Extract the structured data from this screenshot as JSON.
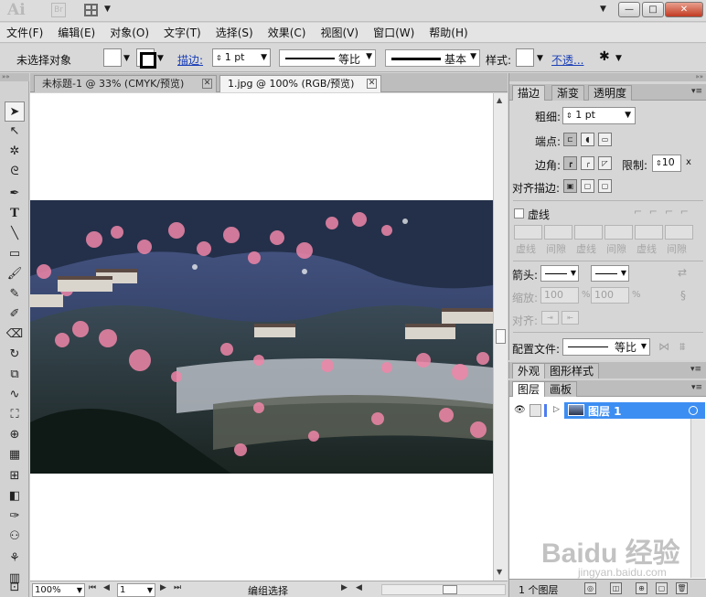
{
  "app": {
    "logo": "Ai",
    "bridge_label": "Br"
  },
  "window_buttons": {
    "minimize": "—",
    "maximize": "□",
    "close": "✕"
  },
  "menu": [
    "文件(F)",
    "编辑(E)",
    "对象(O)",
    "文字(T)",
    "选择(S)",
    "效果(C)",
    "视图(V)",
    "窗口(W)",
    "帮助(H)"
  ],
  "control_bar": {
    "selection_status": "未选择对象",
    "stroke_label": "描边:",
    "stroke_weight": "1 pt",
    "profile_label": "等比",
    "brush_label": "基本",
    "style_label": "样式:",
    "opacity_label": "不透..."
  },
  "doc_tabs": [
    {
      "label": "未标题-1 @ 33% (CMYK/预览)",
      "active": false
    },
    {
      "label": "1.jpg @ 100% (RGB/预览)",
      "active": true
    }
  ],
  "status_bar": {
    "zoom": "100%",
    "page": "1",
    "mode": "编组选择"
  },
  "stroke_panel": {
    "tabs": [
      "描边",
      "渐变",
      "透明度"
    ],
    "weight_label": "粗细:",
    "weight_value": "1 pt",
    "cap_label": "端点:",
    "corner_label": "边角:",
    "limit_label": "限制:",
    "limit_value": "10",
    "limit_unit": "x",
    "align_label": "对齐描边:",
    "dashed_label": "虚线",
    "dash_labels": [
      "虚线",
      "间隙",
      "虚线",
      "间隙",
      "虚线",
      "间隙"
    ],
    "arrow_label": "箭头:",
    "scale_label": "缩放:",
    "scale_left": "100",
    "scale_right": "100",
    "percent": "%",
    "align_arrow_label": "对齐:",
    "profile_label": "配置文件:",
    "profile_value": "等比"
  },
  "appearance_panel": {
    "tabs": [
      "外观",
      "图形样式"
    ]
  },
  "layers_panel": {
    "tabs": [
      "图层",
      "画板"
    ],
    "layer_name": "图层 1",
    "count": "1 个图层"
  },
  "watermark": {
    "main": "Baidu 经验",
    "sub": "jingyan.baidu.com"
  },
  "colors": {
    "selection_blue": "#3d8ef2",
    "link_blue": "#1a3fb8",
    "close_red": "#c23a22"
  }
}
